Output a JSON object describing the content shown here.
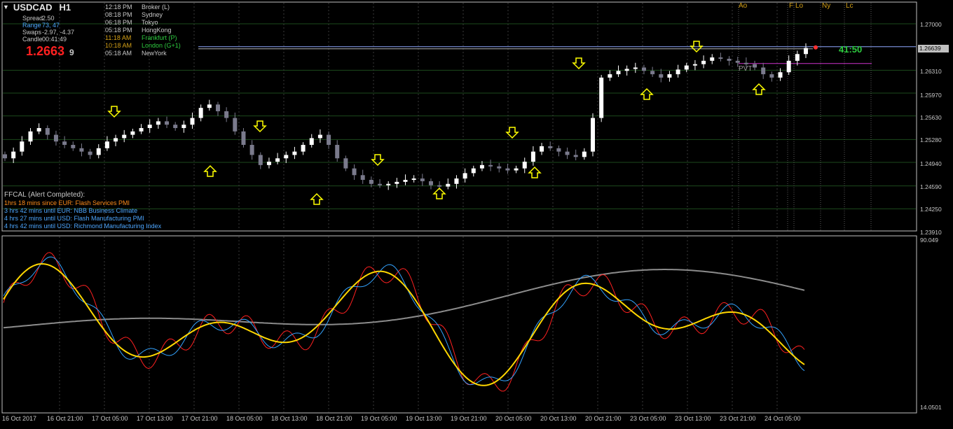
{
  "header": {
    "symbol": "USDCAD",
    "timeframe": "H1",
    "spread_label": "Spread",
    "spread_value": "2.50",
    "range_label": "Range",
    "range_value": "73, 47",
    "swaps_label": "Swaps",
    "swaps_value": "-2.97, -4.37",
    "candle_label": "Candle",
    "candle_value": "00:41:49",
    "price_main": "1.2663",
    "price_pip": "9"
  },
  "sessions": [
    {
      "time": "12:18 PM",
      "name": "Broker  (L)",
      "color": "#c8c8c8"
    },
    {
      "time": "08:18 PM",
      "name": "Sydney",
      "color": "#c8c8c8"
    },
    {
      "time": "06:18 PM",
      "name": "Tokyo",
      "color": "#c8c8c8"
    },
    {
      "time": "05:18 PM",
      "name": "HongKong",
      "color": "#c8c8c8"
    },
    {
      "time": "11:18 AM",
      "name": "Frankfurt  (P)",
      "color": "#2ecc40"
    },
    {
      "time": "10:18 AM",
      "name": "London  (G+1)",
      "color": "#2ecc40"
    },
    {
      "time": "05:18 AM",
      "name": "NewYork",
      "color": "#c8c8c8"
    }
  ],
  "ffcal": {
    "header": "FFCAL  (Alert Completed):",
    "items": [
      {
        "text": "1hrs 18 mins since EUR: Flash Services PMI",
        "color": "#ff8c1a"
      },
      {
        "text": "3 hrs 42 mins until EUR: NBB Business Climate",
        "color": "#4da6ff"
      },
      {
        "text": "4 hrs 27 mins until USD: Flash Manufacturing PMI",
        "color": "#4da6ff"
      },
      {
        "text": "4 hrs 42 mins until USD: Richmond Manufacturing Index",
        "color": "#4da6ff"
      }
    ]
  },
  "session_labels": [
    {
      "text": "Ao"
    },
    {
      "text": "F"
    },
    {
      "text": "Lo"
    },
    {
      "text": "Ny"
    },
    {
      "text": "Lc"
    }
  ],
  "timer": "41:50",
  "pivot_label": "PVT",
  "current_price_label": "1.26639",
  "price_axis": [
    "1.27000",
    "1.26310",
    "1.25970",
    "1.25630",
    "1.25280",
    "1.24940",
    "1.24590",
    "1.24250",
    "1.23910"
  ],
  "oscillator_axis": {
    "max": "90.049",
    "min": "14.0501"
  },
  "time_axis": [
    "16 Oct 2017",
    "16 Oct 21:00",
    "17 Oct 05:00",
    "17 Oct 13:00",
    "17 Oct 21:00",
    "18 Oct 05:00",
    "18 Oct 13:00",
    "18 Oct 21:00",
    "19 Oct 05:00",
    "19 Oct 13:00",
    "19 Oct 21:00",
    "20 Oct 05:00",
    "20 Oct 13:00",
    "20 Oct 21:00",
    "23 Oct 05:00",
    "23 Oct 13:00",
    "23 Oct 21:00",
    "24 Oct 05:00"
  ],
  "colors": {
    "background": "#000000",
    "bull_candle": "#ffffff",
    "bear_candle": "#7a7a8c",
    "arrow": "#ffff00",
    "osc_fast": "#ff2020",
    "osc_mid": "#33a3ff",
    "osc_signal": "#ffd700",
    "osc_slow": "#8c8c8c",
    "pivot_line": "#cc33cc",
    "price_line": "#8fa8ff"
  },
  "chart_data": {
    "type": "candlestick",
    "symbol": "USDCAD",
    "timeframe": "H1",
    "close_path": [
      1.25,
      1.251,
      1.2525,
      1.254,
      1.2545,
      1.2535,
      1.2525,
      1.252,
      1.2515,
      1.251,
      1.2505,
      1.2515,
      1.2525,
      1.253,
      1.2535,
      1.254,
      1.2545,
      1.255,
      1.2555,
      1.255,
      1.2545,
      1.255,
      1.256,
      1.2575,
      1.258,
      1.257,
      1.256,
      1.254,
      1.252,
      1.2505,
      1.249,
      1.2495,
      1.25,
      1.2505,
      1.251,
      1.252,
      1.253,
      1.2535,
      1.252,
      1.25,
      1.2485,
      1.2475,
      1.2468,
      1.2462,
      1.246,
      1.2462,
      1.2465,
      1.2468,
      1.247,
      1.2466,
      1.246,
      1.2458,
      1.2462,
      1.247,
      1.2478,
      1.2485,
      1.249,
      1.2488,
      1.2485,
      1.2482,
      1.2485,
      1.2495,
      1.251,
      1.2518,
      1.2515,
      1.251,
      1.2505,
      1.2502,
      1.251,
      1.256,
      1.262,
      1.2625,
      1.263,
      1.2633,
      1.2635,
      1.263,
      1.2625,
      1.262,
      1.2625,
      1.2632,
      1.2638,
      1.264,
      1.2645,
      1.265,
      1.2648,
      1.2645,
      1.2642,
      1.264,
      1.2635,
      1.2625,
      1.262,
      1.2628,
      1.2645,
      1.2655,
      1.2664
    ],
    "pivot": 1.2641,
    "current_price": 1.26639
  }
}
